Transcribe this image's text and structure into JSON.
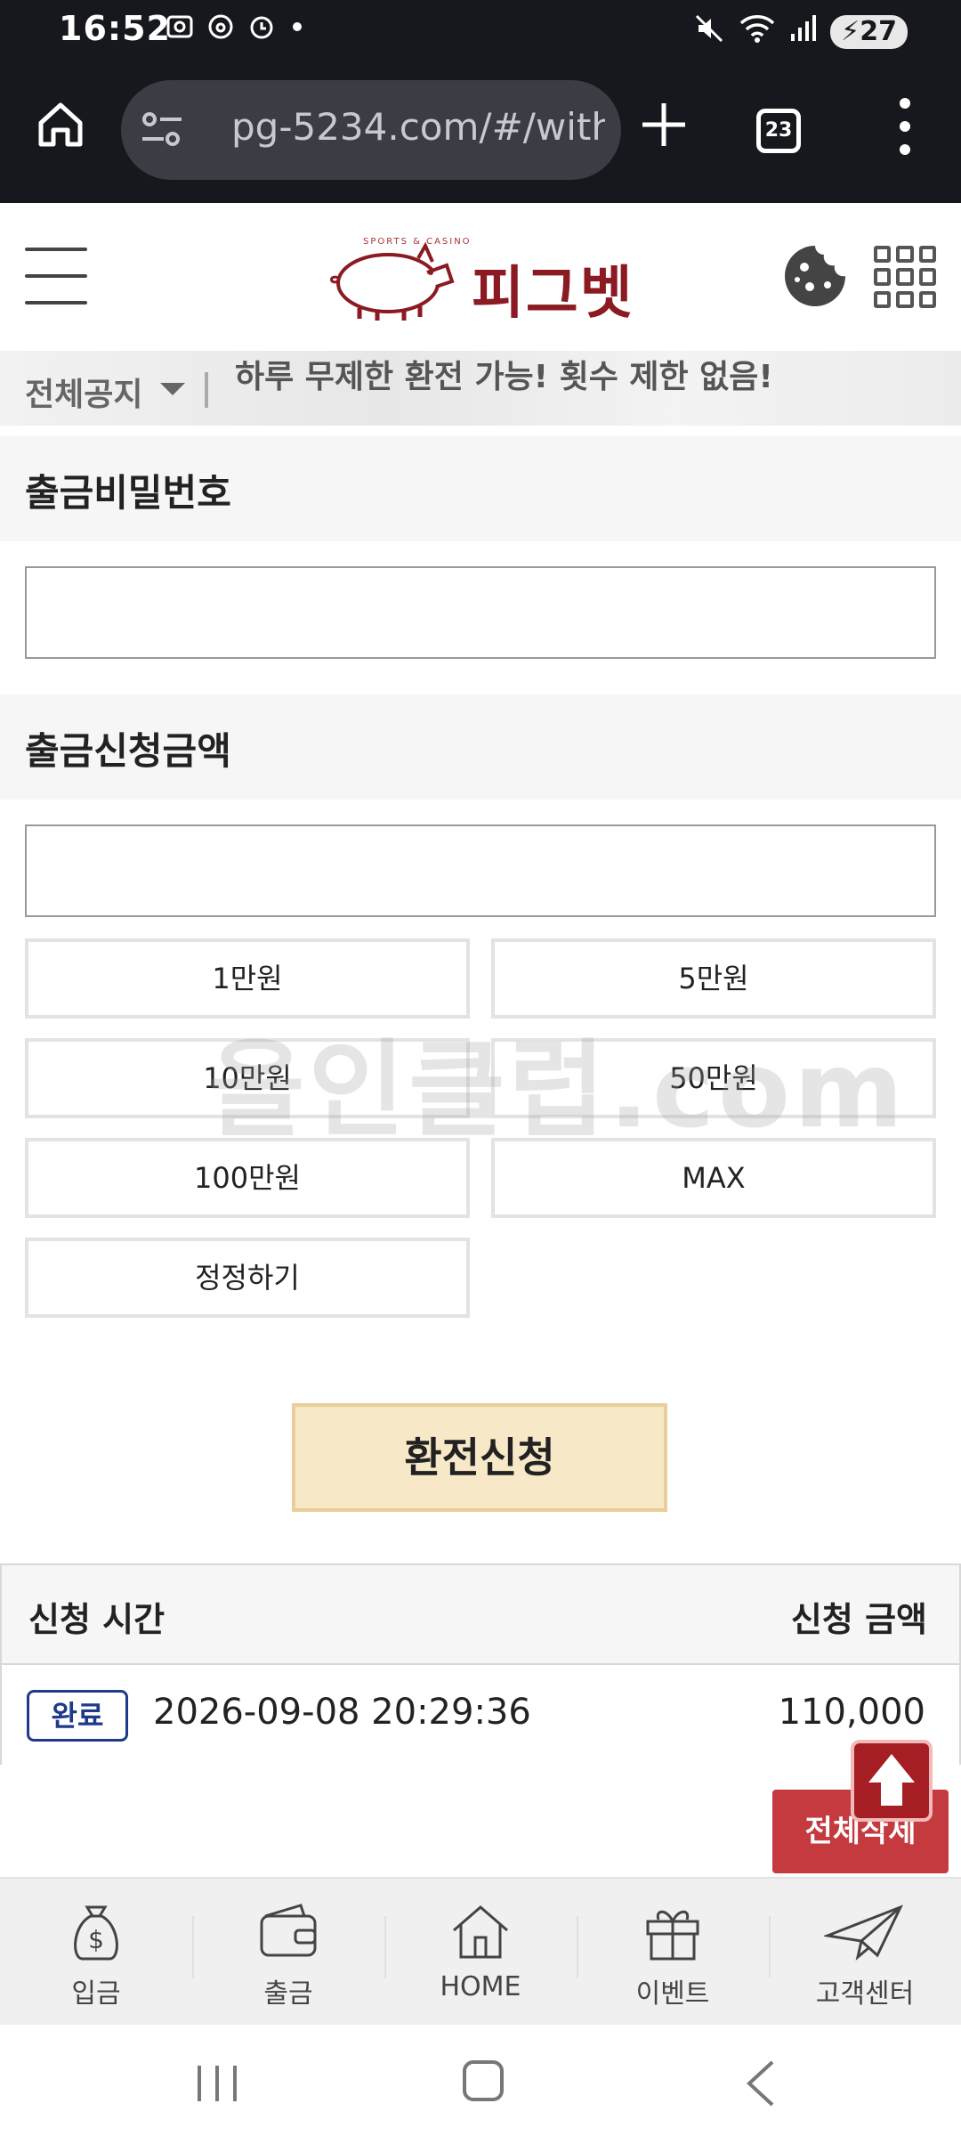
{
  "status_bar": {
    "time": "16:52",
    "battery": "27",
    "left_icons": [
      "screenshot-icon",
      "threads-icon",
      "alarm-icon",
      "dot-icon"
    ],
    "right_icons": [
      "mute-icon",
      "wifi-icon",
      "signal-icon",
      "battery-icon"
    ]
  },
  "browser": {
    "url": "pg-5234.com/#/with",
    "tab_count": "23"
  },
  "header": {
    "logo_text": "피그벳",
    "logo_sub": "SPORTS & CASINO"
  },
  "notice": {
    "category": "전체공지",
    "message": "하루 무제한 환전 가능! 횟수 제한 없음!"
  },
  "form": {
    "password_label": "출금비밀번호",
    "password_value": "",
    "amount_label": "출금신청금액",
    "amount_value": "",
    "quick_buttons": [
      "1만원",
      "5만원",
      "10만원",
      "50만원",
      "100만원",
      "MAX",
      "정정하기"
    ],
    "submit_label": "환전신청"
  },
  "watermark": "올인클럽.com",
  "history": {
    "col_time": "신청 시간",
    "col_amount": "신청 금액",
    "rows": [
      {
        "status": "완료",
        "time": "2026-09-08 20:29:36",
        "amount": "110,000"
      }
    ],
    "delete_all_label": "전체삭제"
  },
  "bottom_nav": {
    "items": [
      {
        "label": "입금",
        "icon": "money-bag-icon"
      },
      {
        "label": "출금",
        "icon": "wallet-icon"
      },
      {
        "label": "HOME",
        "icon": "house-icon"
      },
      {
        "label": "이벤트",
        "icon": "gift-icon"
      },
      {
        "label": "고객센터",
        "icon": "paper-plane-icon"
      }
    ]
  },
  "colors": {
    "brand": "#8b1a22",
    "submit_bg": "#f7e8c8",
    "delete_bg": "#c53a3f",
    "badge": "#1f3a8a"
  }
}
